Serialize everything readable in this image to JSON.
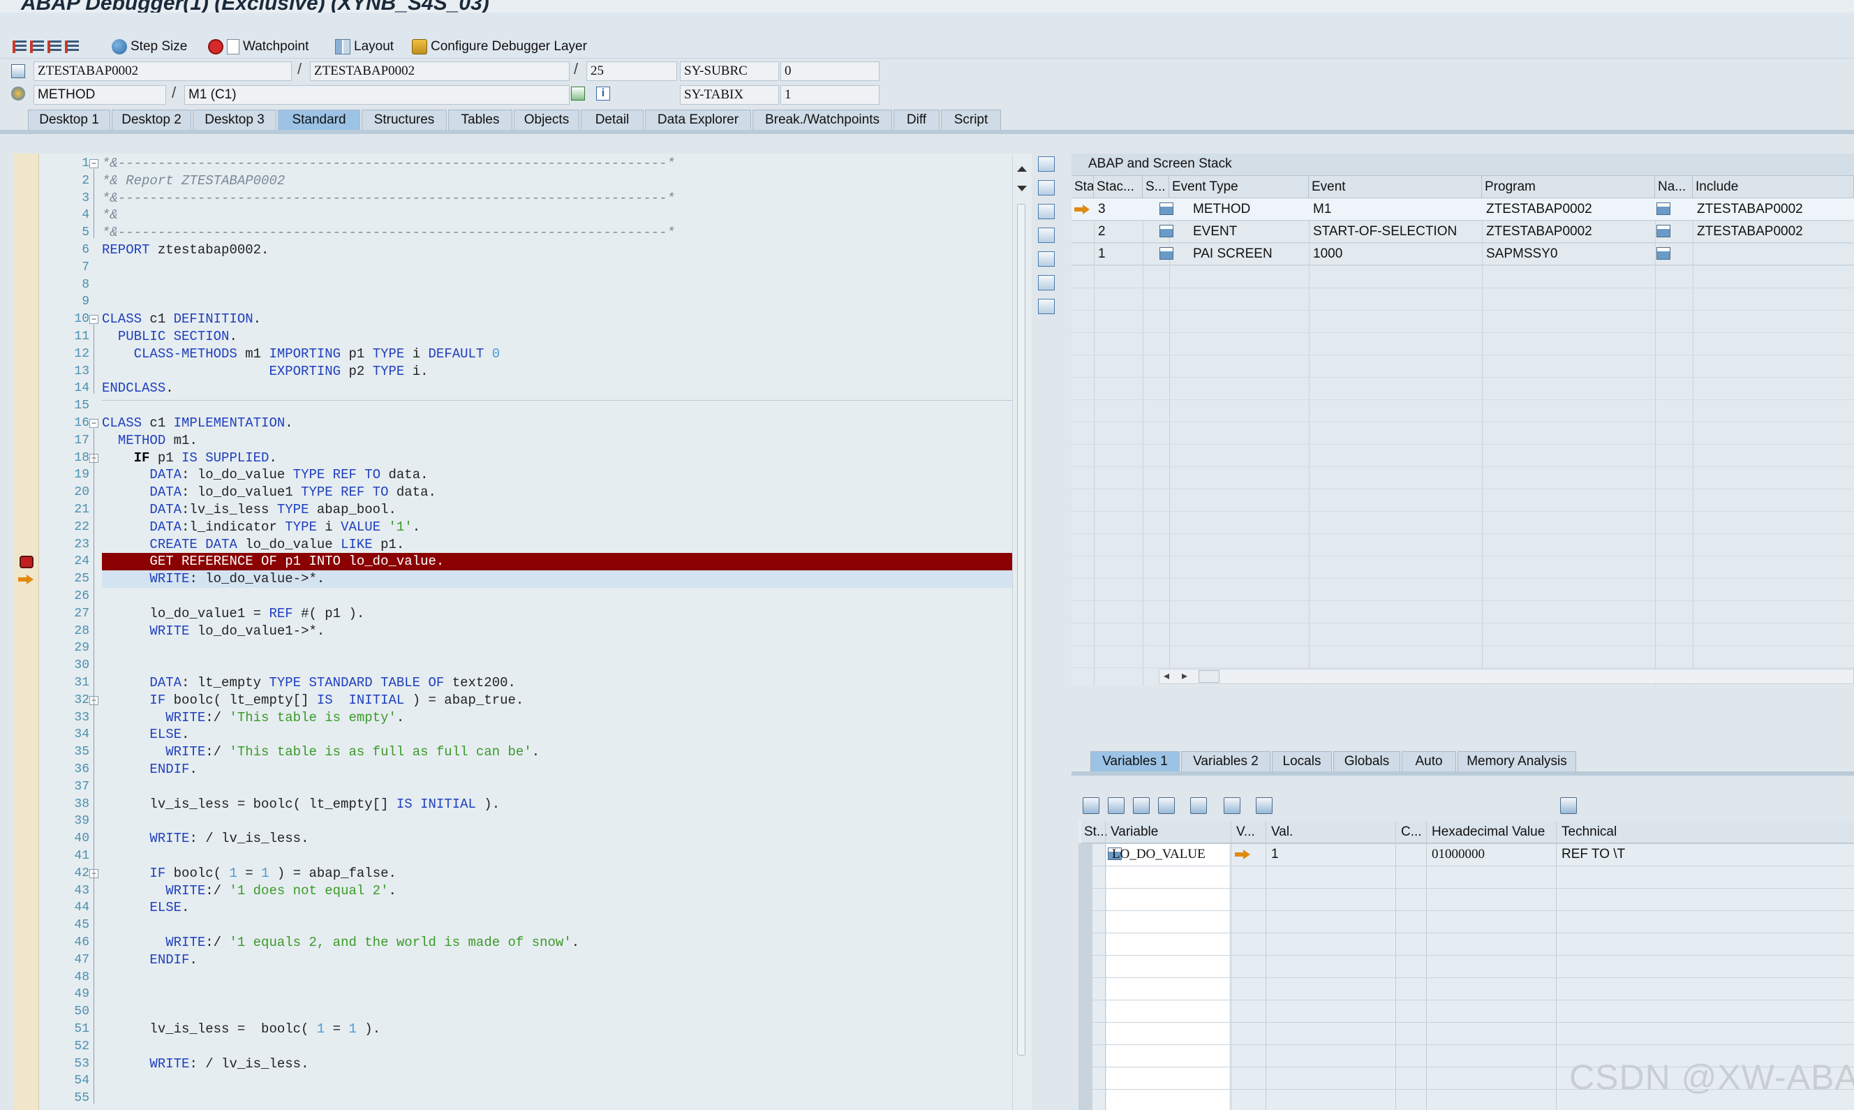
{
  "window": {
    "title": "ABAP Debugger(1)  (Exclusive) (XYNB_S4S_03)"
  },
  "toolbar": {
    "step_size": "Step Size",
    "watchpoint": "Watchpoint",
    "layout": "Layout",
    "configure": "Configure Debugger Layer"
  },
  "header": {
    "program1": "ZTESTABAP0002",
    "program2": "ZTESTABAP0002",
    "line": "25",
    "subrc_label": "SY-SUBRC",
    "subrc_value": "0",
    "type": "METHOD",
    "method": "M1 (C1)",
    "tabix_label": "SY-TABIX",
    "tabix_value": "1"
  },
  "tabs": [
    "Desktop 1",
    "Desktop 2",
    "Desktop 3",
    "Standard",
    "Structures",
    "Tables",
    "Objects",
    "Detail",
    "Data Explorer",
    "Break./Watchpoints",
    "Diff",
    "Script"
  ],
  "stack": {
    "title": "ABAP and Screen Stack",
    "columns": [
      "Sta...",
      "Stac...",
      "S...",
      "Event Type",
      "Event",
      "Program",
      "Na...",
      "Include"
    ],
    "rows": [
      {
        "level": "3",
        "event_type": "METHOD",
        "event": "M1",
        "program": "ZTESTABAP0002",
        "include": "ZTESTABAP0002"
      },
      {
        "level": "2",
        "event_type": "EVENT",
        "event": "START-OF-SELECTION",
        "program": "ZTESTABAP0002",
        "include": "ZTESTABAP0002"
      },
      {
        "level": "1",
        "event_type": "PAI SCREEN",
        "event": "1000",
        "program": "SAPMSSY0",
        "include": ""
      }
    ]
  },
  "var_tabs": [
    "Variables 1",
    "Variables 2",
    "Locals",
    "Globals",
    "Auto",
    "Memory Analysis"
  ],
  "variables": {
    "columns": [
      "St...",
      "Variable",
      "V...",
      "Val.",
      "C...",
      "Hexadecimal Value",
      "Technical"
    ],
    "rows": [
      {
        "name": "LO_DO_VALUE",
        "value": "1",
        "hex": "01000000",
        "technical": "REF TO \\T"
      }
    ]
  },
  "code": {
    "lines": [
      "1",
      "2",
      "3",
      "4",
      "5",
      "6",
      "7",
      "8",
      "9",
      "10",
      "11",
      "12",
      "13",
      "14",
      "15",
      "16",
      "17",
      "18",
      "19",
      "20",
      "21",
      "22",
      "23",
      "24",
      "25",
      "26",
      "27",
      "28",
      "29",
      "30",
      "31",
      "32",
      "33",
      "34",
      "35",
      "36",
      "37",
      "38",
      "39",
      "40",
      "41",
      "42",
      "43",
      "44",
      "45",
      "46",
      "47",
      "48",
      "49",
      "50",
      "51",
      "52",
      "53",
      "54",
      "55"
    ]
  },
  "watermark": "CSDN @XW-ABAP"
}
